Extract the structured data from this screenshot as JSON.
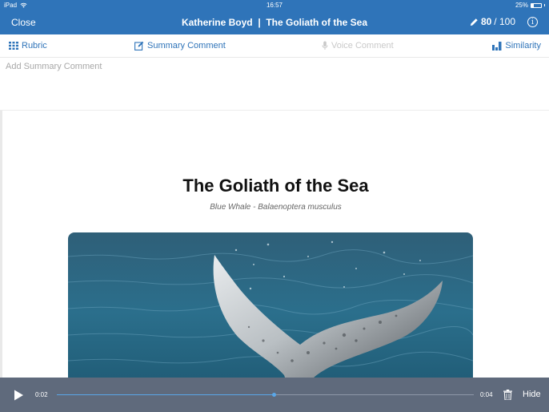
{
  "status_bar": {
    "device": "iPad",
    "time": "16:57",
    "battery": "25%"
  },
  "nav": {
    "close_label": "Close",
    "student_name": "Katherine Boyd",
    "separator": "|",
    "assignment_title": "The Goliath of the Sea",
    "score": "80",
    "score_total": "/ 100",
    "info_glyph": "i"
  },
  "toolbar": {
    "rubric_label": "Rubric",
    "summary_label": "Summary Comment",
    "voice_label": "Voice Comment",
    "similarity_label": "Similarity"
  },
  "summary": {
    "placeholder": "Add Summary Comment"
  },
  "document": {
    "title": "The Goliath of the Sea",
    "subtitle": "Blue Whale - Balaenoptera musculus"
  },
  "player": {
    "current_time": "0:02",
    "total_time": "0:04",
    "progress": 0.52,
    "hide_label": "Hide"
  },
  "colors": {
    "brand": "#2f74b9",
    "player_bg": "#5f6a7c",
    "progress": "#5aa7e8"
  }
}
